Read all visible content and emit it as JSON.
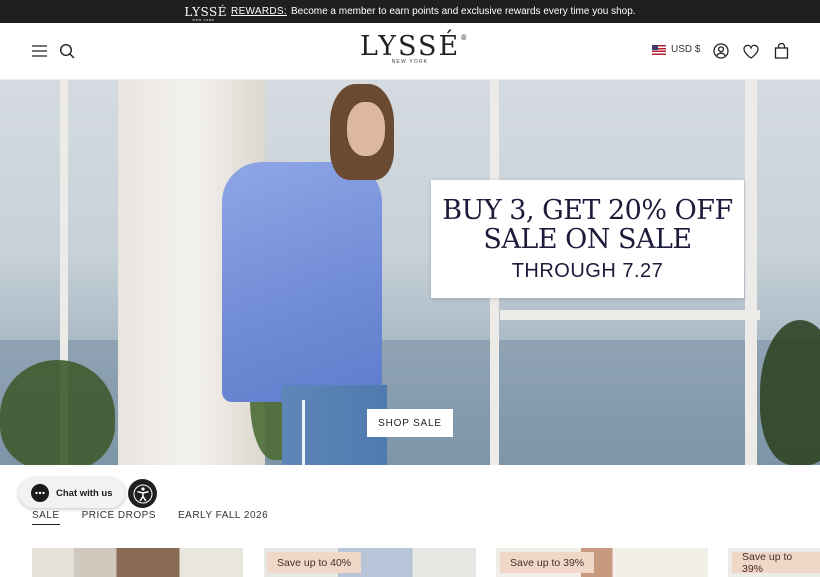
{
  "announcement": {
    "logo": "LYSSÉ",
    "logo_sub": "NEW YORK",
    "rewards_link": "REWARDS:",
    "message": "Become a member to earn points and exclusive rewards every time you shop."
  },
  "header": {
    "logo": "LYSSÉ",
    "logo_mark": "®",
    "logo_city": "NEW YORK",
    "currency": "USD $",
    "icons": [
      "menu-icon",
      "search-icon",
      "us-flag-icon",
      "account-icon",
      "wishlist-heart-icon",
      "bag-icon"
    ]
  },
  "hero": {
    "promo_line1": "BUY 3, GET 20% OFF",
    "promo_line2": "SALE ON SALE",
    "promo_line3": "THROUGH 7.27",
    "cta": "SHOP SALE"
  },
  "widgets": {
    "chat_label": "Chat with us"
  },
  "tabs": [
    {
      "label": "SALE",
      "active": true
    },
    {
      "label": "PRICE DROPS",
      "active": false
    },
    {
      "label": "EARLY FALL 2026",
      "active": false
    }
  ],
  "products": [
    {
      "badge": ""
    },
    {
      "badge": "Save up to 40%"
    },
    {
      "badge": "Save up to 39%"
    },
    {
      "badge": "Save up to 39%"
    }
  ],
  "colors": {
    "announcement_bg": "#1f1f1f",
    "badge_bg": "#f0d7c8",
    "promo_text": "#1b1b3a"
  }
}
